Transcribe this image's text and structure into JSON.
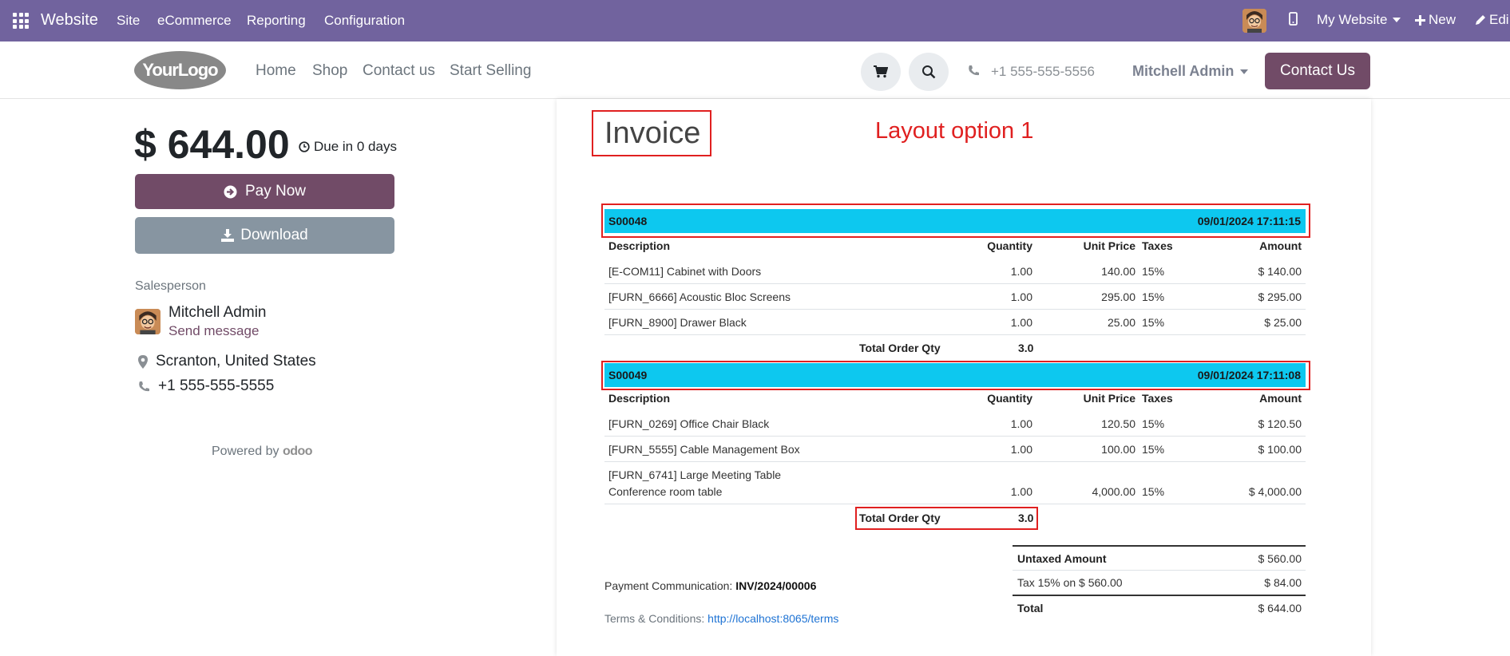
{
  "topbar": {
    "app_name": "Website",
    "menus": [
      "Site",
      "eCommerce",
      "Reporting",
      "Configuration"
    ],
    "my_website": "My Website",
    "new_label": "New",
    "edit_label": "Edi"
  },
  "header": {
    "logo_text": "YourLogo",
    "nav": [
      "Home",
      "Shop",
      "Contact us",
      "Start Selling"
    ],
    "phone": "+1 555-555-5556",
    "user": "Mitchell Admin",
    "contact_button": "Contact Us"
  },
  "summary": {
    "amount": "$ 644.00",
    "due": "Due in 0 days",
    "pay_now": "Pay Now",
    "download": "Download",
    "salesperson_label": "Salesperson",
    "salesperson_name": "Mitchell Admin",
    "send_message": "Send message",
    "location": "Scranton, United States",
    "phone": "+1 555-555-5555",
    "powered_by": "Powered by",
    "powered_brand": "odoo"
  },
  "invoice": {
    "title": "Invoice",
    "annotation": "Layout option 1",
    "columns": {
      "description": "Description",
      "quantity": "Quantity",
      "unit_price": "Unit Price",
      "taxes": "Taxes",
      "amount": "Amount"
    },
    "total_qty_label": "Total Order Qty",
    "orders": [
      {
        "ref": "S00048",
        "date": "09/01/2024 17:11:15",
        "lines": [
          {
            "description": "[E-COM11] Cabinet with Doors",
            "quantity": "1.00",
            "unit_price": "140.00",
            "taxes": "15%",
            "amount": "$ 140.00"
          },
          {
            "description": "[FURN_6666] Acoustic Bloc Screens",
            "quantity": "1.00",
            "unit_price": "295.00",
            "taxes": "15%",
            "amount": "$ 295.00"
          },
          {
            "description": "[FURN_8900] Drawer Black",
            "quantity": "1.00",
            "unit_price": "25.00",
            "taxes": "15%",
            "amount": "$ 25.00"
          }
        ],
        "total_qty": "3.0"
      },
      {
        "ref": "S00049",
        "date": "09/01/2024 17:11:08",
        "lines": [
          {
            "description": "[FURN_0269] Office Chair Black",
            "quantity": "1.00",
            "unit_price": "120.50",
            "taxes": "15%",
            "amount": "$ 120.50"
          },
          {
            "description": "[FURN_5555] Cable Management Box",
            "quantity": "1.00",
            "unit_price": "100.00",
            "taxes": "15%",
            "amount": "$ 100.00"
          },
          {
            "description": "[FURN_6741] Large Meeting Table",
            "description2": "Conference room table",
            "quantity": "1.00",
            "unit_price": "4,000.00",
            "taxes": "15%",
            "amount": "$ 4,000.00"
          }
        ],
        "total_qty": "3.0"
      }
    ],
    "payment_label": "Payment Communication:",
    "payment_ref": "INV/2024/00006",
    "terms_label": "Terms & Conditions:",
    "terms_link": "http://localhost:8065/terms",
    "totals": {
      "untaxed_label": "Untaxed Amount",
      "untaxed_value": "$ 560.00",
      "tax_label": "Tax 15% on $ 560.00",
      "tax_value": "$ 84.00",
      "total_label": "Total",
      "total_value": "$ 644.00"
    }
  },
  "colors": {
    "topbar": "#71639e",
    "primary": "#714b67",
    "secondary": "#8795a1",
    "order_bar": "#0dc8ef",
    "annotation": "#e02020"
  }
}
